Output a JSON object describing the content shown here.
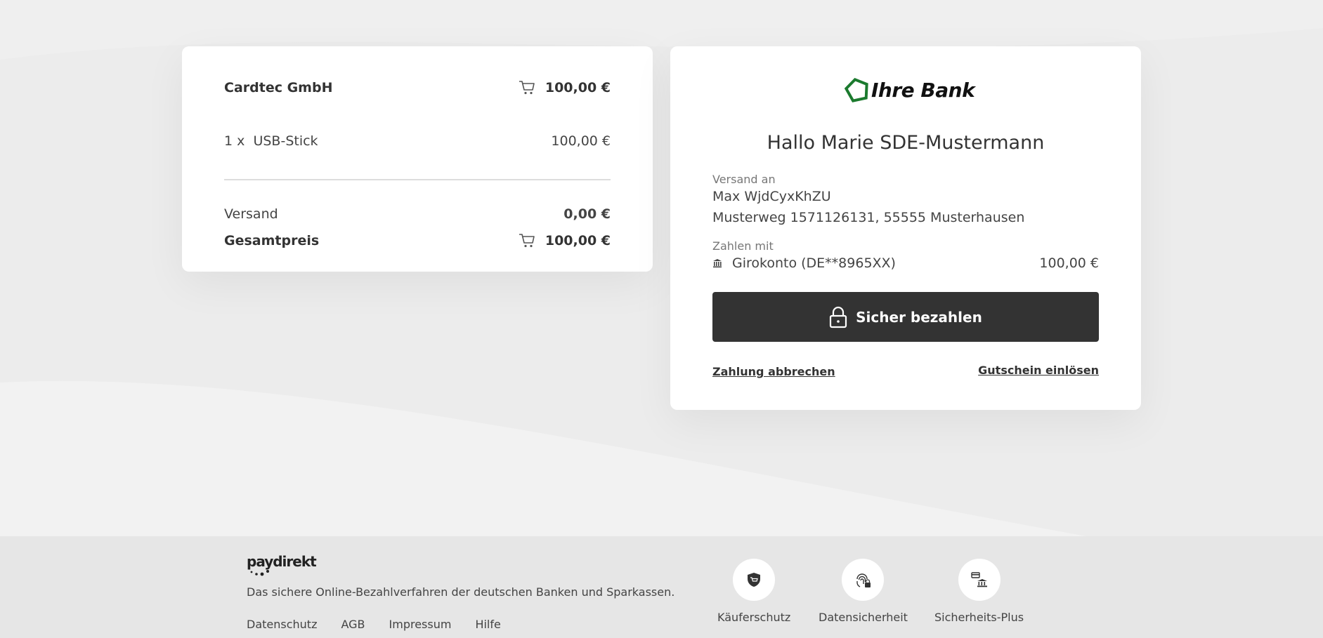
{
  "order": {
    "merchant": "Cardtec GmbH",
    "header_amount": "100,00 €",
    "item_qty": "1 x",
    "item_name": "USB-Stick",
    "item_amount": "100,00 €",
    "shipping_label": "Versand",
    "shipping_amount": "0,00 €",
    "total_label": "Gesamtpreis",
    "total_amount": "100,00 €"
  },
  "payment": {
    "bank_name": "Ihre Bank",
    "greeting": "Hallo Marie SDE-Mustermann",
    "ship_to_label": "Versand an",
    "ship_to_name": "Max WjdCyxKhZU",
    "ship_to_address": "Musterweg 1571126131, 55555 Musterhausen",
    "pay_with_label": "Zahlen mit",
    "account": "Girokonto (DE**8965XX)",
    "account_amount": "100,00 €",
    "pay_button": "Sicher bezahlen",
    "cancel_link": "Zahlung abbrechen",
    "voucher_link": "Gutschein einlösen"
  },
  "footer": {
    "brand": "paydirekt",
    "description": "Das sichere Online-Bezahlverfahren der deutschen Banken und Sparkassen.",
    "links": [
      "Datenschutz",
      "AGB",
      "Impressum",
      "Hilfe"
    ],
    "features": [
      "Käuferschutz",
      "Datensicherheit",
      "Sicherheits-Plus"
    ]
  },
  "colors": {
    "background": "#efefef",
    "button": "#333333",
    "bank_logo_green": "#1b7a2e",
    "footer": "#e6e6e6"
  },
  "icons": [
    "cart-icon",
    "bank-icon",
    "lock-icon",
    "shield-cart-icon",
    "fingerprint-lock-icon",
    "card-bank-icon"
  ]
}
